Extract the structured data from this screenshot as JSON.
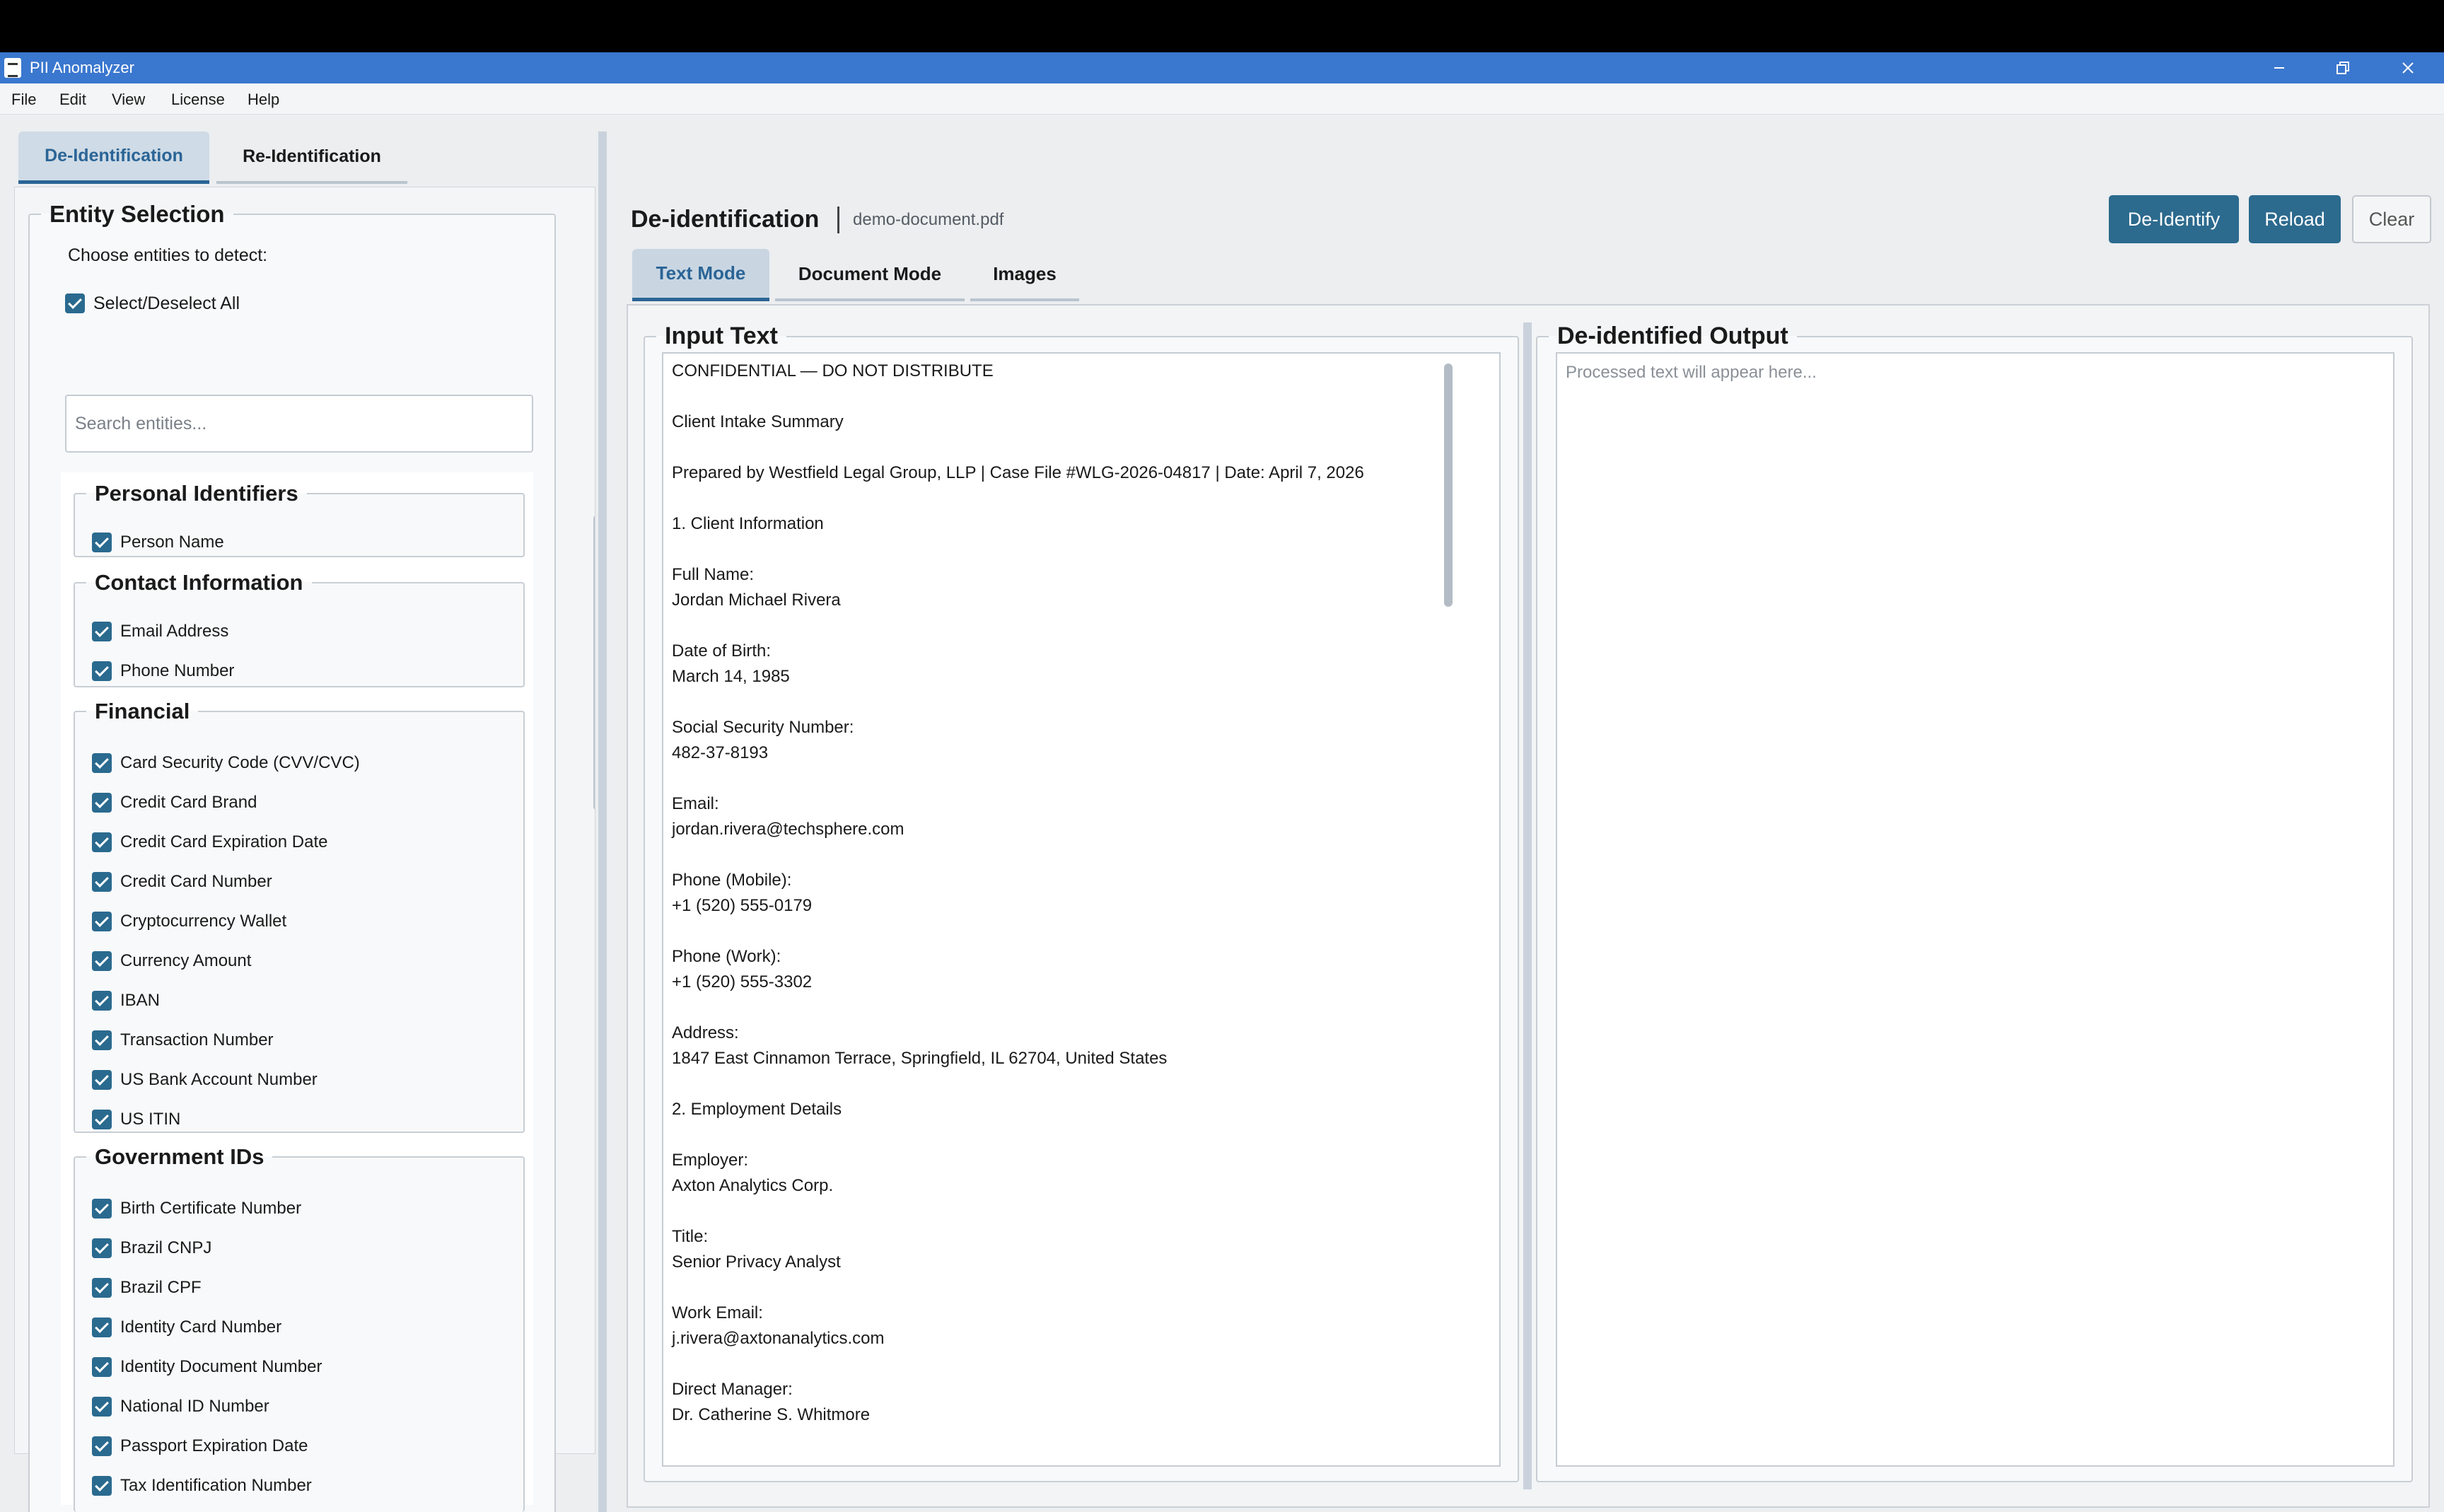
{
  "window": {
    "title": "PII Anomalyzer"
  },
  "menu": [
    "File",
    "Edit",
    "View",
    "License",
    "Help"
  ],
  "left_panel": {
    "tabs": [
      "De-Identification",
      "Re-Identification"
    ],
    "active_tab": "De-Identification",
    "entity_selection": {
      "title": "Entity Selection",
      "prompt": "Choose entities to detect:",
      "select_all_label": "Select/Deselect All",
      "select_all_checked": true,
      "search_placeholder": "Search entities...",
      "categories": [
        {
          "name": "Personal Identifiers",
          "items": [
            "Person Name"
          ]
        },
        {
          "name": "Contact Information",
          "items": [
            "Email Address",
            "Phone Number"
          ]
        },
        {
          "name": "Financial",
          "items": [
            "Card Security Code (CVV/CVC)",
            "Credit Card Brand",
            "Credit Card Expiration Date",
            "Credit Card Number",
            "Cryptocurrency Wallet",
            "Currency Amount",
            "IBAN",
            "Transaction Number",
            "US Bank Account Number",
            "US ITIN"
          ]
        },
        {
          "name": "Government IDs",
          "items": [
            "Birth Certificate Number",
            "Brazil CNPJ",
            "Brazil CPF",
            "Identity Card Number",
            "Identity Document Number",
            "National ID Number",
            "Passport Expiration Date",
            "Tax Identification Number"
          ]
        }
      ]
    }
  },
  "main": {
    "header": {
      "title": "De-identification",
      "filename": "demo-document.pdf"
    },
    "actions": {
      "deidentify": "De-Identify",
      "reload": "Reload",
      "clear": "Clear"
    },
    "mode_tabs": [
      "Text Mode",
      "Document Mode",
      "Images"
    ],
    "active_mode": "Text Mode",
    "input": {
      "title": "Input Text",
      "lines": [
        "CONFIDENTIAL — DO NOT DISTRIBUTE",
        "",
        "Client Intake Summary",
        "",
        "Prepared by Westfield Legal Group, LLP | Case File #WLG-2026-04817 | Date: April 7, 2026",
        "",
        "1. Client Information",
        "",
        "Full Name:",
        "Jordan Michael Rivera",
        "",
        "Date of Birth:",
        "March 14, 1985",
        "",
        "Social Security Number:",
        "482-37-8193",
        "",
        "Email:",
        "jordan.rivera@techsphere.com",
        "",
        "Phone (Mobile):",
        "+1 (520) 555-0179",
        "",
        "Phone (Work):",
        "+1 (520) 555-3302",
        "",
        "Address:",
        "1847 East Cinnamon Terrace, Springfield, IL 62704, United States",
        "",
        "2. Employment Details",
        "",
        "Employer:",
        "Axton Analytics Corp.",
        "",
        "Title:",
        "Senior Privacy Analyst",
        "",
        "Work Email:",
        "j.rivera@axtonanalytics.com",
        "",
        "Direct Manager:",
        "Dr. Catherine S. Whitmore"
      ]
    },
    "output": {
      "title": "De-identified Output",
      "placeholder": "Processed text will appear here..."
    }
  },
  "colors": {
    "titlebar": "#3a77cf",
    "accent": "#2c6a8e",
    "active_tab_text": "#2a6496",
    "active_tab_bg": "#cfdbe6"
  },
  "icons": {
    "app": "app-document-icon",
    "minimize": "minimize-icon",
    "maximize": "restore-icon",
    "close": "close-icon",
    "checkbox": "checkbox-checked-icon"
  }
}
